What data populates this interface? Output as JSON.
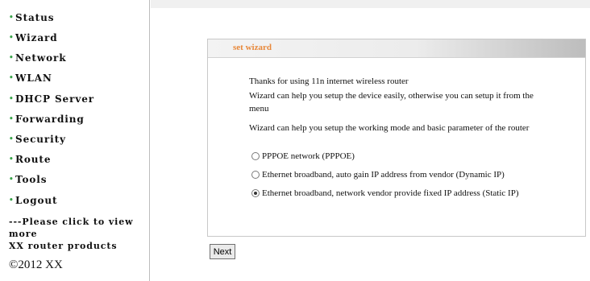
{
  "sidebar": {
    "bullet": "•",
    "items": [
      {
        "label": "Status"
      },
      {
        "label": "Wizard"
      },
      {
        "label": "Network"
      },
      {
        "label": "WLAN"
      },
      {
        "label": "DHCP Server"
      },
      {
        "label": "Forwarding"
      },
      {
        "label": "Security"
      },
      {
        "label": "Route"
      },
      {
        "label": "Tools"
      },
      {
        "label": "Logout"
      }
    ],
    "promo": {
      "line1": "---Please click to view",
      "line2": "more",
      "line3": "XX router products"
    },
    "copyright": "©2012 XX"
  },
  "wizard": {
    "title": "set wizard",
    "text1": "Thanks for using 11n internet wireless router",
    "text2a": "Wizard can help you setup the device easily, otherwise you can setup it from the",
    "text2b": "menu",
    "text3": "Wizard can help you setup the working mode and basic parameter of the router",
    "options": [
      {
        "label": "PPPOE network (PPPOE)",
        "checked": false
      },
      {
        "label": "Ethernet broadband, auto gain IP address from vendor (Dynamic IP)",
        "checked": false
      },
      {
        "label": "Ethernet broadband, network vendor provide fixed IP address (Static IP)",
        "checked": true
      }
    ],
    "next_label": "Next"
  },
  "colors": {
    "title": "#e8883a",
    "bullet": "#3aa34a"
  }
}
